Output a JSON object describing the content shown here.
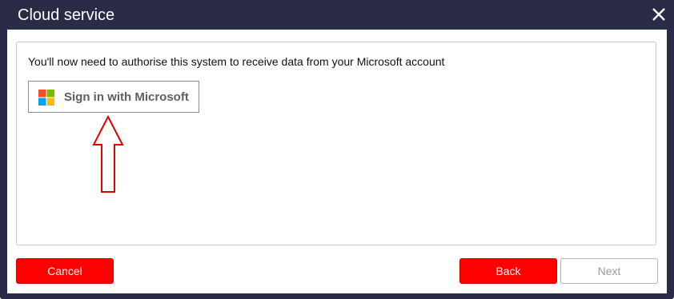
{
  "window": {
    "title": "Cloud service",
    "close_icon": "close-icon"
  },
  "content": {
    "instruction": "You'll now need to authorise this system to receive data from your Microsoft account",
    "signin_button": {
      "label": "Sign in with Microsoft",
      "icon": "microsoft-logo-icon"
    },
    "annotation_arrow": {
      "color": "#e00000",
      "direction": "up"
    }
  },
  "footer": {
    "cancel_label": "Cancel",
    "back_label": "Back",
    "next_label": "Next",
    "next_disabled": true
  },
  "colors": {
    "titlebar": "#2a2b47",
    "primary_button": "#ff0000",
    "ms_red": "#f25022",
    "ms_green": "#7fba00",
    "ms_blue": "#00a4ef",
    "ms_yellow": "#ffb900"
  }
}
